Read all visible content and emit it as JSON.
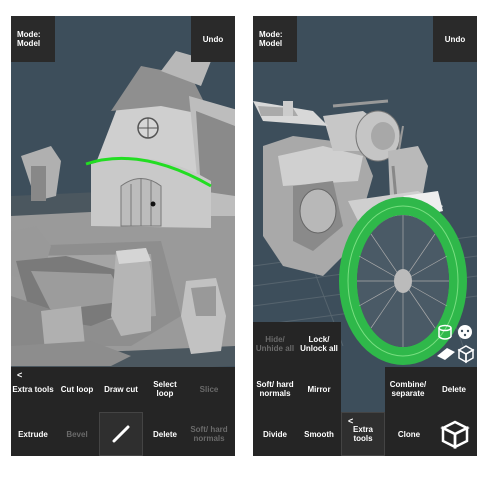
{
  "left": {
    "mode_label": "Mode:\nModel",
    "undo_label": "Undo",
    "toolbar_row1": [
      {
        "label": "Extra tools",
        "back": "<",
        "enabled": true
      },
      {
        "label": "Cut loop",
        "enabled": true
      },
      {
        "label": "Draw cut",
        "enabled": true
      },
      {
        "label": "Select loop",
        "enabled": true
      },
      {
        "label": "Slice",
        "enabled": false
      }
    ],
    "toolbar_row2": [
      {
        "label": "Extrude",
        "enabled": true
      },
      {
        "label": "Bevel",
        "enabled": false
      },
      {
        "label": "",
        "enabled": true,
        "icon": "pencil-icon"
      },
      {
        "label": "Delete",
        "enabled": true
      },
      {
        "label": "Soft/ hard normals",
        "enabled": false
      }
    ]
  },
  "right": {
    "mode_label": "Mode:\nModel",
    "undo_label": "Undo",
    "side_col": [
      {
        "label": "Hide/ Unhide all",
        "enabled": false
      },
      {
        "label": "Lock/ Unlock all",
        "enabled": true
      },
      {
        "label": "Soft/ hard normals",
        "enabled": true
      },
      {
        "label": "Mirror",
        "enabled": true
      }
    ],
    "row_upper_right": [
      {
        "label": "Combine/ separate",
        "enabled": true
      },
      {
        "label": "Delete",
        "enabled": true
      }
    ],
    "toolbar_row2": [
      {
        "label": "Divide",
        "enabled": true
      },
      {
        "label": "Smooth",
        "enabled": true
      },
      {
        "label": "Extra tools",
        "back": "<",
        "enabled": true
      },
      {
        "label": "Clone",
        "enabled": true
      },
      {
        "label": "",
        "enabled": true,
        "icon": "cube-icon"
      }
    ]
  }
}
